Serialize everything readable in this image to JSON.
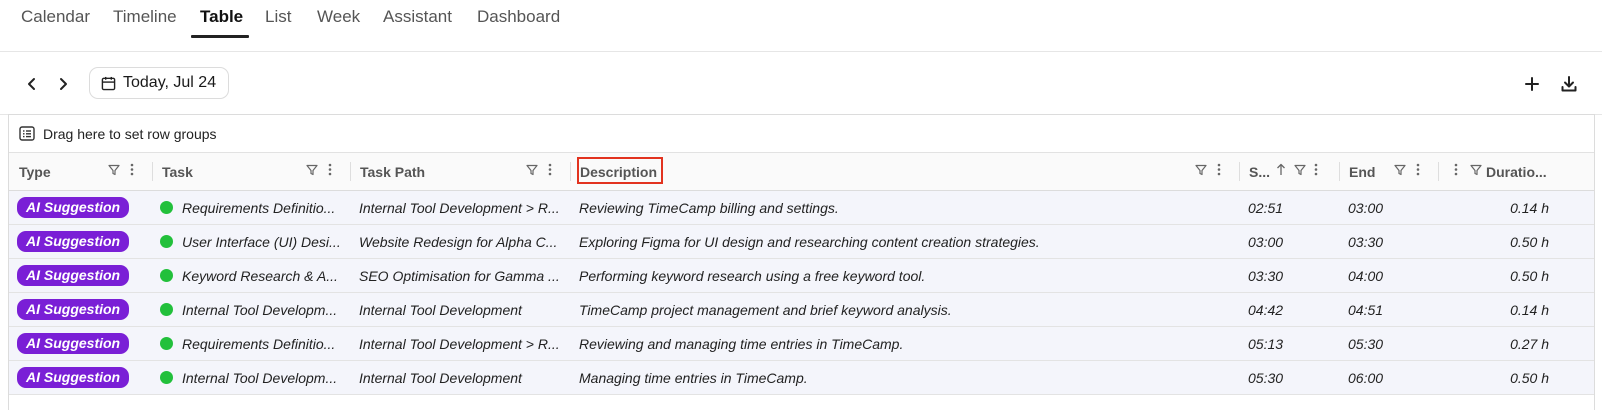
{
  "nav": {
    "tabs": [
      {
        "label": "Calendar"
      },
      {
        "label": "Timeline"
      },
      {
        "label": "Table"
      },
      {
        "label": "List"
      },
      {
        "label": "Week"
      },
      {
        "label": "Assistant"
      },
      {
        "label": "Dashboard"
      }
    ],
    "active_tab": "Table"
  },
  "toolbar": {
    "date_label": "Today, Jul 24",
    "prev_icon": "chevron-left-icon",
    "next_icon": "chevron-right-icon",
    "add_icon": "plus-icon",
    "download_icon": "download-icon"
  },
  "grid": {
    "group_bar_text": "Drag here to set row groups",
    "columns": {
      "type": "Type",
      "task": "Task",
      "task_path": "Task Path",
      "description": "Description",
      "start": "S...",
      "end": "End",
      "duration": "Duratio..."
    },
    "highlighted_column": "Description",
    "highlight_color": "#e2331f",
    "badge_color": "#7a1fd6",
    "status_color": "#22c03b",
    "rows": [
      {
        "type": "AI Suggestion",
        "task": "Requirements Definitio...",
        "task_path": "Internal Tool Development > R...",
        "description": "Reviewing TimeCamp billing and settings.",
        "start": "02:51",
        "end": "03:00",
        "duration": "0.14 h"
      },
      {
        "type": "AI Suggestion",
        "task": "User Interface (UI) Desi...",
        "task_path": "Website Redesign for Alpha C...",
        "description": "Exploring Figma for UI design and researching content creation strategies.",
        "start": "03:00",
        "end": "03:30",
        "duration": "0.50 h"
      },
      {
        "type": "AI Suggestion",
        "task": "Keyword Research & A...",
        "task_path": "SEO Optimisation for Gamma ...",
        "description": "Performing keyword research using a free keyword tool.",
        "start": "03:30",
        "end": "04:00",
        "duration": "0.50 h"
      },
      {
        "type": "AI Suggestion",
        "task": "Internal Tool Developm...",
        "task_path": "Internal Tool Development",
        "description": "TimeCamp project management and brief keyword analysis.",
        "start": "04:42",
        "end": "04:51",
        "duration": "0.14 h"
      },
      {
        "type": "AI Suggestion",
        "task": "Requirements Definitio...",
        "task_path": "Internal Tool Development > R...",
        "description": "Reviewing and managing time entries in TimeCamp.",
        "start": "05:13",
        "end": "05:30",
        "duration": "0.27 h"
      },
      {
        "type": "AI Suggestion",
        "task": "Internal Tool Developm...",
        "task_path": "Internal Tool Development",
        "description": "Managing time entries in TimeCamp.",
        "start": "05:30",
        "end": "06:00",
        "duration": "0.50 h"
      }
    ]
  }
}
